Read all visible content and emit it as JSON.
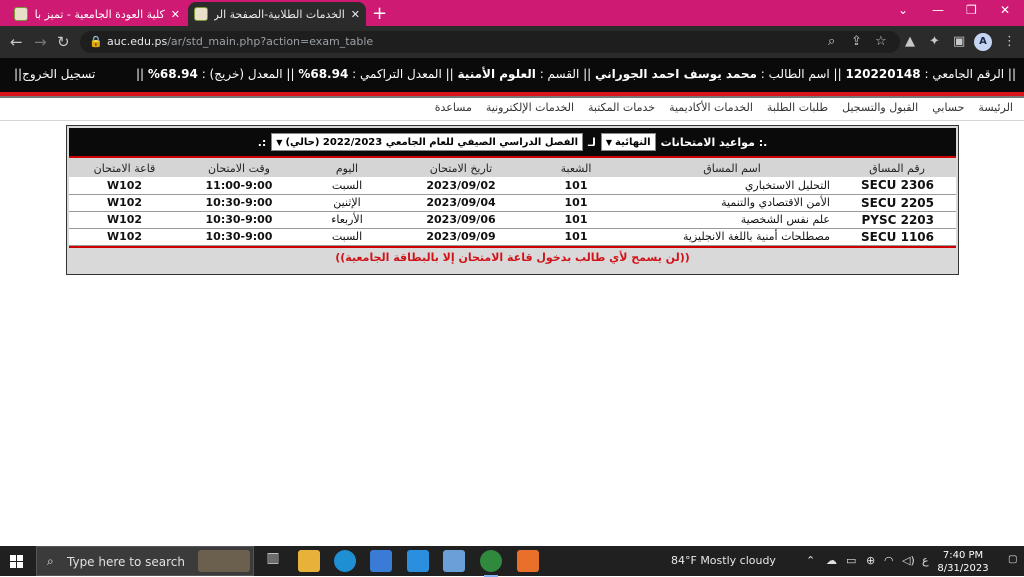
{
  "browser": {
    "tabs": [
      {
        "label": "كلية العودة الجامعية - تميز بانضمامك",
        "active": false
      },
      {
        "label": "الخدمات الطلابية-الصفحة الرئيسية",
        "active": true
      }
    ],
    "new_tab": "+",
    "url_host": "auc.edu.ps",
    "url_path": "/ar/std_main.php?action=exam_table",
    "avatar_letter": "A",
    "accent_color": "#cf1a74"
  },
  "student_bar": {
    "id_label": "|| الرقم الجامعي :",
    "id_value": "120220148",
    "name_label": "|| اسم الطالب :",
    "name_value": "محمد يوسف احمد الجوراني",
    "dept_label": "|| القسم :",
    "dept_value": "العلوم الأمنية",
    "cum_label": "|| المعدل التراكمي :",
    "cum_value": "68.94%",
    "gpa_label": "|| المعدل (خريج) :",
    "gpa_value": "68.94%",
    "end_sep": "||",
    "logout": "||تسجيل الخروج"
  },
  "menu": [
    "الرئيسة",
    "حسابي",
    "القبول والتسجيل",
    "طلبات الطلبة",
    "الخدمات الأكاديمية",
    "خدمات المكتبة",
    "الخدمات الإلكترونية",
    "مساعدة"
  ],
  "exam_panel": {
    "title": ".: مواعيد الامتحانات",
    "exam_type": "النهائية",
    "for_label": "لـ",
    "semester": "الفصل الدراسي الصيفي للعام الجامعي 2022/2023 (حالي)",
    "end_mark": ":.",
    "columns": [
      "رقم المساق",
      "اسم المساق",
      "الشعبة",
      "تاريخ الامتحان",
      "اليوم",
      "وقت الامتحان",
      "قاعة الامتحان"
    ],
    "rows": [
      {
        "code": "SECU 2306",
        "name": "التحليل الاستخباري",
        "section": "101",
        "date": "2023/09/02",
        "day": "السبت",
        "time": "11:00-9:00",
        "room": "W102"
      },
      {
        "code": "SECU 2205",
        "name": "الأمن الاقتصادي والتنمية",
        "section": "101",
        "date": "2023/09/04",
        "day": "الإثنين",
        "time": "10:30-9:00",
        "room": "W102"
      },
      {
        "code": "PYSC 2203",
        "name": "علم نفس الشخصية",
        "section": "101",
        "date": "2023/09/06",
        "day": "الأربعاء",
        "time": "10:30-9:00",
        "room": "W102"
      },
      {
        "code": "SECU 1106",
        "name": "مصطلحات أمنية باللغة الانجليزية",
        "section": "101",
        "date": "2023/09/09",
        "day": "السبت",
        "time": "10:30-9:00",
        "room": "W102"
      }
    ],
    "notice": "((لن يسمح لأي طالب بدخول قاعة الامتحان إلا بالبطاقة الجامعية))"
  },
  "taskbar": {
    "search_placeholder": "Type here to search",
    "weather": "84°F  Mostly cloudy",
    "lang": "ع",
    "time": "7:40 PM",
    "date": "8/31/2023"
  }
}
